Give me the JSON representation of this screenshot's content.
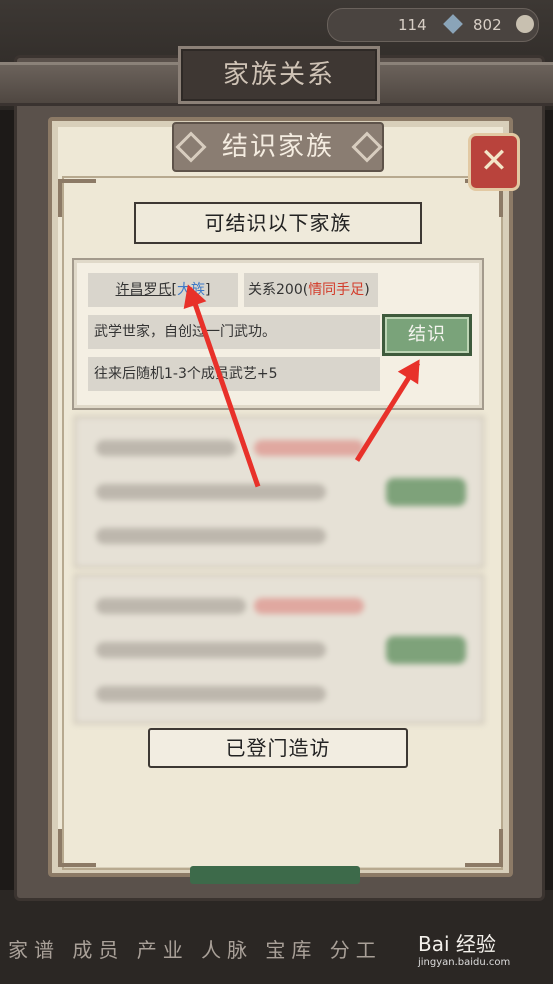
{
  "resources": {
    "value1": "114",
    "value2": "802"
  },
  "window_title": "家族关系",
  "panel_title": "结识家族",
  "subtitle": "可结识以下家族",
  "family": {
    "name": "许昌罗氏",
    "bracket_open": "[",
    "tag": "大族",
    "bracket_close": "]",
    "relation_label": "关系200(",
    "relation_status": "情同手足",
    "relation_close": ")",
    "description": "武学世家，自创过一门武功。",
    "bonus": "往来后随机1-3个成员武艺+5",
    "befriend_label": "结识"
  },
  "visited_label": "已登门造访",
  "bottom_nav": "家谱 成员 产业 人脉 宝库 分工",
  "watermark": {
    "brand": "Bai 经验",
    "url": "jingyan.baidu.com"
  },
  "colors": {
    "accent_red": "#d33b2a",
    "tag_blue": "#3d79c7",
    "button_green": "#7aa37a",
    "arrow": "#e8312a"
  }
}
